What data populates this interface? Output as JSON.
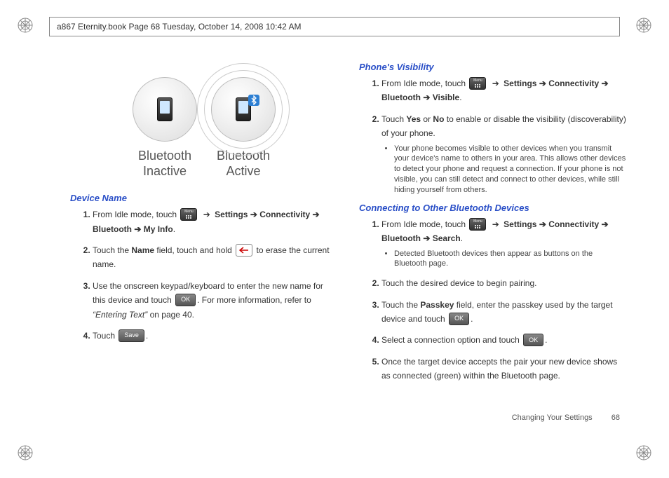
{
  "header": {
    "running_head": "a867 Eternity.book  Page 68  Tuesday, October 14, 2008  10:42 AM"
  },
  "figure": {
    "inactive_label": "Bluetooth\nInactive",
    "active_label": "Bluetooth\nActive"
  },
  "icons": {
    "arrow": "➔",
    "ok_label": "OK",
    "save_label": "Save",
    "menu_label": "Menu"
  },
  "left_column": {
    "device_name": {
      "heading": "Device Name",
      "step1": {
        "prefix": "From Idle mode, touch ",
        "path": "Settings ➔ Connectivity ➔ Bluetooth ➔ My Info",
        "suffix": "."
      },
      "step2": {
        "prefix": "Touch the ",
        "bold1": "Name",
        "mid": " field, touch and hold ",
        "suffix": " to erase the current name."
      },
      "step3": {
        "prefix": "Use the onscreen keypad/keyboard to enter the new name for this device and touch ",
        "mid": ". For more information, refer to ",
        "ref": "“Entering Text”",
        "suffix": "  on page 40."
      },
      "step4": {
        "prefix": "Touch ",
        "suffix": "."
      }
    }
  },
  "right_column": {
    "visibility": {
      "heading": "Phone's Visibility",
      "step1": {
        "prefix": "From Idle mode, touch ",
        "path": "Settings ➔ Connectivity ➔ Bluetooth ➔ Visible",
        "suffix": "."
      },
      "step2": {
        "prefix": "Touch ",
        "bold1": "Yes",
        "mid1": " or ",
        "bold2": "No",
        "suffix": " to enable or disable the visibility (discoverability) of your phone."
      },
      "bullet1": "Your phone becomes visible to other devices when you transmit your device's name to others in your area. This allows other devices to detect your phone and request a connection. If your phone is not visible, you can still detect and connect to other devices, while still hiding yourself from others."
    },
    "connecting": {
      "heading": "Connecting to Other Bluetooth Devices",
      "step1": {
        "prefix": "From Idle mode, touch ",
        "path": "Settings ➔ Connectivity ➔ Bluetooth ➔ Search",
        "suffix": "."
      },
      "bullet1": "Detected Bluetooth devices then appear as buttons on the Bluetooth page.",
      "step2": "Touch the desired device to begin pairing.",
      "step3": {
        "prefix": "Touch the ",
        "bold1": "Passkey",
        "mid": " field, enter the passkey used by the target device and touch ",
        "suffix": "."
      },
      "step4": {
        "prefix": "Select a connection option and touch ",
        "suffix": "."
      },
      "step5": "Once the target device accepts the pair your new device shows as connected (green) within the Bluetooth page."
    }
  },
  "footer": {
    "section_label": "Changing Your Settings",
    "page_number": "68"
  }
}
